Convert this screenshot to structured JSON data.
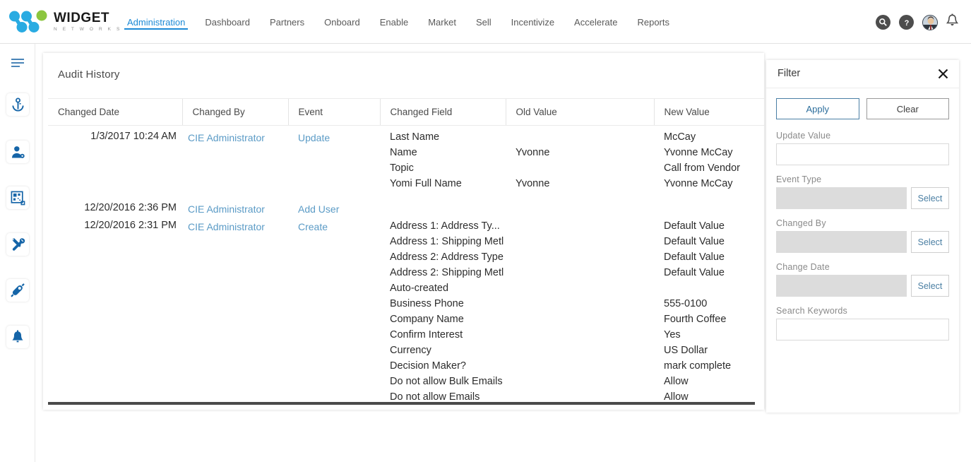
{
  "brand": {
    "name": "WIDGET",
    "tagline": "N E T W O R K S",
    "logo_icon": "widget-networks-logo",
    "accent_blue": "#29ABE2",
    "accent_green": "#8CC63F"
  },
  "nav": {
    "items": [
      {
        "label": "Administration",
        "active": true
      },
      {
        "label": "Dashboard",
        "active": false
      },
      {
        "label": "Partners",
        "active": false
      },
      {
        "label": "Onboard",
        "active": false
      },
      {
        "label": "Enable",
        "active": false
      },
      {
        "label": "Market",
        "active": false
      },
      {
        "label": "Sell",
        "active": false
      },
      {
        "label": "Incentivize",
        "active": false
      },
      {
        "label": "Accelerate",
        "active": false
      },
      {
        "label": "Reports",
        "active": false
      }
    ],
    "active_color": "#1c8ad6"
  },
  "top_icons": [
    {
      "name": "search-icon"
    },
    {
      "name": "help-icon"
    },
    {
      "name": "user-avatar-icon"
    },
    {
      "name": "notification-bell-icon"
    }
  ],
  "rail": {
    "items": [
      {
        "name": "hamburger-menu-icon",
        "boxed": false
      },
      {
        "name": "anchor-key-icon",
        "boxed": true
      },
      {
        "name": "user-settings-icon",
        "boxed": true
      },
      {
        "name": "dashboard-grid-icon",
        "boxed": true
      },
      {
        "name": "tools-icon",
        "boxed": true
      },
      {
        "name": "rocket-plug-icon",
        "boxed": true
      },
      {
        "name": "bell-icon",
        "boxed": true
      }
    ],
    "icon_color": "#1565a8"
  },
  "main": {
    "title": "Audit History",
    "columns": [
      "Changed Date",
      "Changed By",
      "Event",
      "Changed Field",
      "Old Value",
      "New Value"
    ],
    "rows": [
      {
        "changed_date": "1/3/2017 10:24 AM",
        "changed_by": "CIE Administrator",
        "event": "Update",
        "fields": [
          "Last Name",
          "Name",
          "Topic",
          "Yomi Full Name"
        ],
        "old_values": [
          "",
          "Yvonne",
          "",
          "Yvonne"
        ],
        "new_values": [
          "McCay",
          "Yvonne McCay",
          "Call from Vendor",
          "Yvonne McCay"
        ]
      },
      {
        "changed_date": "12/20/2016 2:36 PM",
        "changed_by": "CIE Administrator",
        "event": "Add User",
        "fields": [],
        "old_values": [],
        "new_values": []
      },
      {
        "changed_date": "12/20/2016 2:31 PM",
        "changed_by": "CIE Administrator",
        "event": "Create",
        "fields": [
          "Address 1: Address Ty...",
          "Address 1: Shipping Metl",
          "Address 2: Address Type",
          "Address 2: Shipping Metl",
          "Auto-created",
          "Business Phone",
          "Company Name",
          "Confirm Interest",
          "Currency",
          "Decision Maker?",
          "Do not allow Bulk Emails",
          "Do not allow Emails"
        ],
        "old_values": [
          "",
          "",
          "",
          "",
          "",
          "",
          "",
          "",
          "",
          "",
          "",
          ""
        ],
        "new_values": [
          "Default Value",
          "Default Value",
          "Default Value",
          "Default Value",
          "",
          "555-0100",
          "Fourth Coffee",
          "Yes",
          "US Dollar",
          "mark complete",
          "Allow",
          "Allow"
        ]
      }
    ],
    "link_color": "#5b9bc6",
    "horizontal_scrollbar": true
  },
  "filter": {
    "title": "Filter",
    "close_icon": "close-icon",
    "apply_label": "Apply",
    "clear_label": "Clear",
    "fields": [
      {
        "label": "Update Value",
        "value": "",
        "placeholder": "",
        "disabled": false,
        "has_select": false
      },
      {
        "label": "Event Type",
        "value": "",
        "placeholder": "",
        "disabled": true,
        "has_select": true,
        "select_label": "Select"
      },
      {
        "label": "Changed By",
        "value": "",
        "placeholder": "",
        "disabled": true,
        "has_select": true,
        "select_label": "Select"
      },
      {
        "label": "Change Date",
        "value": "",
        "placeholder": "",
        "disabled": true,
        "has_select": true,
        "select_label": "Select"
      },
      {
        "label": "Search Keywords",
        "value": "",
        "placeholder": "",
        "disabled": false,
        "has_select": false
      }
    ]
  }
}
